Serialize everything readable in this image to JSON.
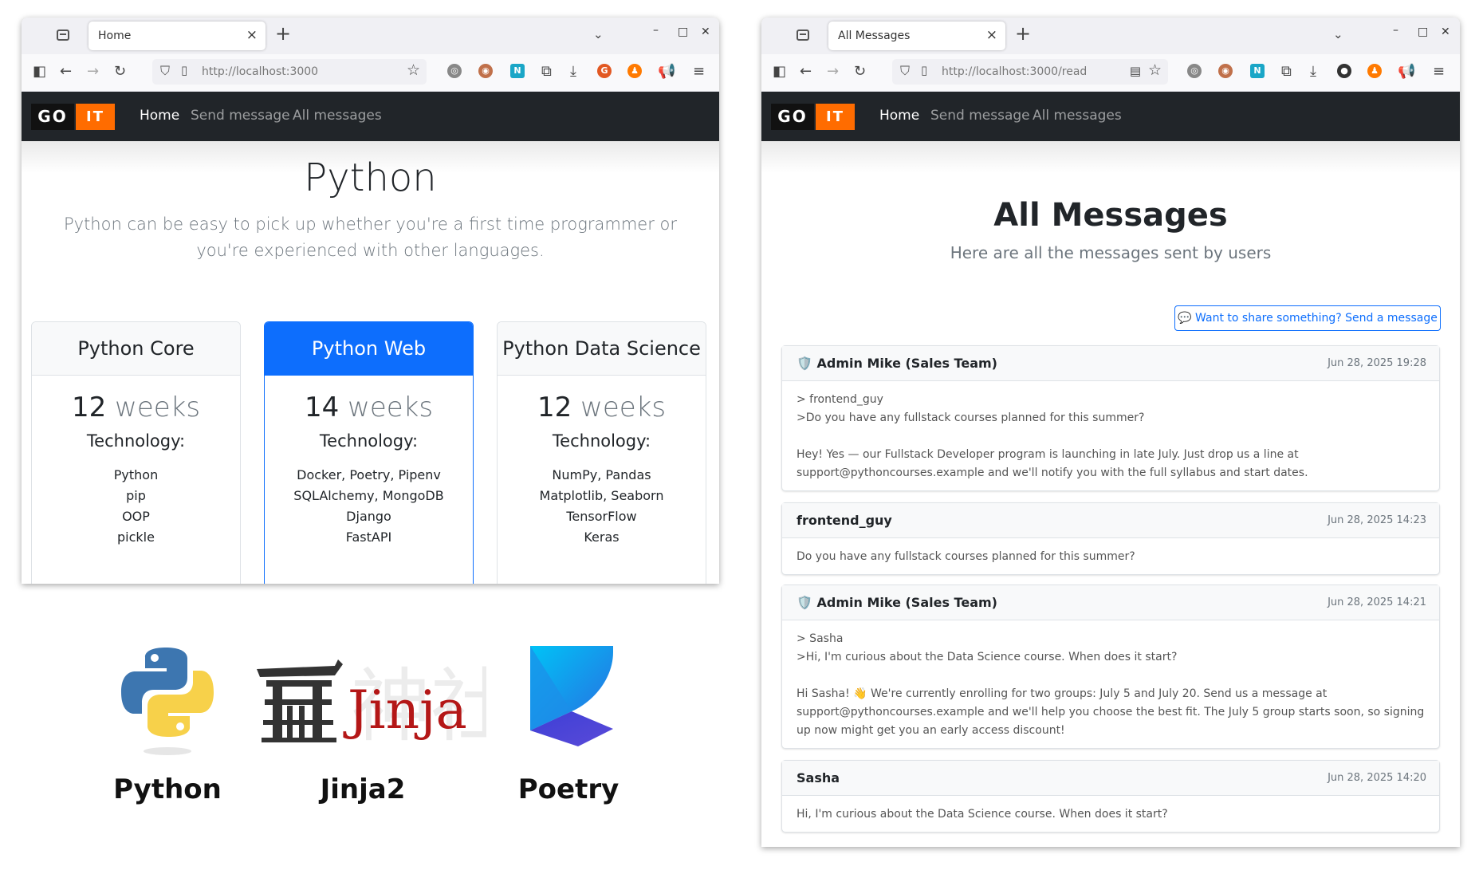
{
  "window1": {
    "tab_title": "Home",
    "url": "http://localhost:3000",
    "nav": {
      "home": "Home",
      "send": "Send message",
      "all": "All messages"
    },
    "logo": {
      "go": "GO",
      "it": "IT"
    },
    "heading": "Python",
    "lead": "Python can be easy to pick up whether you're a first time programmer or you're experienced with other languages.",
    "cards": [
      {
        "title": "Python Core",
        "weeks": "12",
        "unit": "weeks",
        "tech_label": "Technology:",
        "items": [
          "Python",
          "pip",
          "OOP",
          "pickle"
        ]
      },
      {
        "title": "Python Web",
        "weeks": "14",
        "unit": "weeks",
        "tech_label": "Technology:",
        "items": [
          "Docker, Poetry, Pipenv",
          "SQLAlchemy, MongoDB",
          "Django",
          "FastAPI"
        ]
      },
      {
        "title": "Python Data Science",
        "weeks": "12",
        "unit": "weeks",
        "tech_label": "Technology:",
        "items": [
          "NumPy, Pandas",
          "Matplotlib, Seaborn",
          "TensorFlow",
          "Keras"
        ]
      }
    ]
  },
  "logos": [
    {
      "name": "Python"
    },
    {
      "name": "Jinja2",
      "wordmark": "Jinja"
    },
    {
      "name": "Poetry"
    }
  ],
  "window2": {
    "tab_title": "All Messages",
    "url": "http://localhost:3000/read",
    "nav": {
      "home": "Home",
      "send": "Send message",
      "all": "All messages"
    },
    "logo": {
      "go": "GO",
      "it": "IT"
    },
    "title": "All Messages",
    "subtitle": "Here are all the messages sent by users",
    "share_button": "💬 Want to share something? Send a message",
    "messages": [
      {
        "author": "🛡️ Admin Mike (Sales Team)",
        "date": "Jun 28, 2025 19:28",
        "quote_author": "> frontend_guy",
        "quote": ">Do you have any fullstack courses planned for this summer?",
        "body": "Hey! Yes — our Fullstack Developer program is launching in late July. Just drop us a line at support@pythoncourses.example and we'll notify you with the full syllabus and start dates."
      },
      {
        "author": "frontend_guy",
        "date": "Jun 28, 2025 14:23",
        "body": "Do you have any fullstack courses planned for this summer?"
      },
      {
        "author": "🛡️ Admin Mike (Sales Team)",
        "date": "Jun 28, 2025 14:21",
        "quote_author": "> Sasha",
        "quote": ">Hi, I'm curious about the Data Science course. When does it start?",
        "body": "Hi Sasha! 👋 We're currently enrolling for two groups: July 5 and July 20. Send us a message at support@pythoncourses.example and we'll help you choose the best fit. The July 5 group starts soon, so signing up now might get you an early access discount!"
      },
      {
        "author": "Sasha",
        "date": "Jun 28, 2025 14:20",
        "body": "Hi, I'm curious about the Data Science course. When does it start?"
      }
    ]
  },
  "colors": {
    "primary": "#0d6efd",
    "navbar": "#212529",
    "logo_orange": "#ff6c00"
  }
}
